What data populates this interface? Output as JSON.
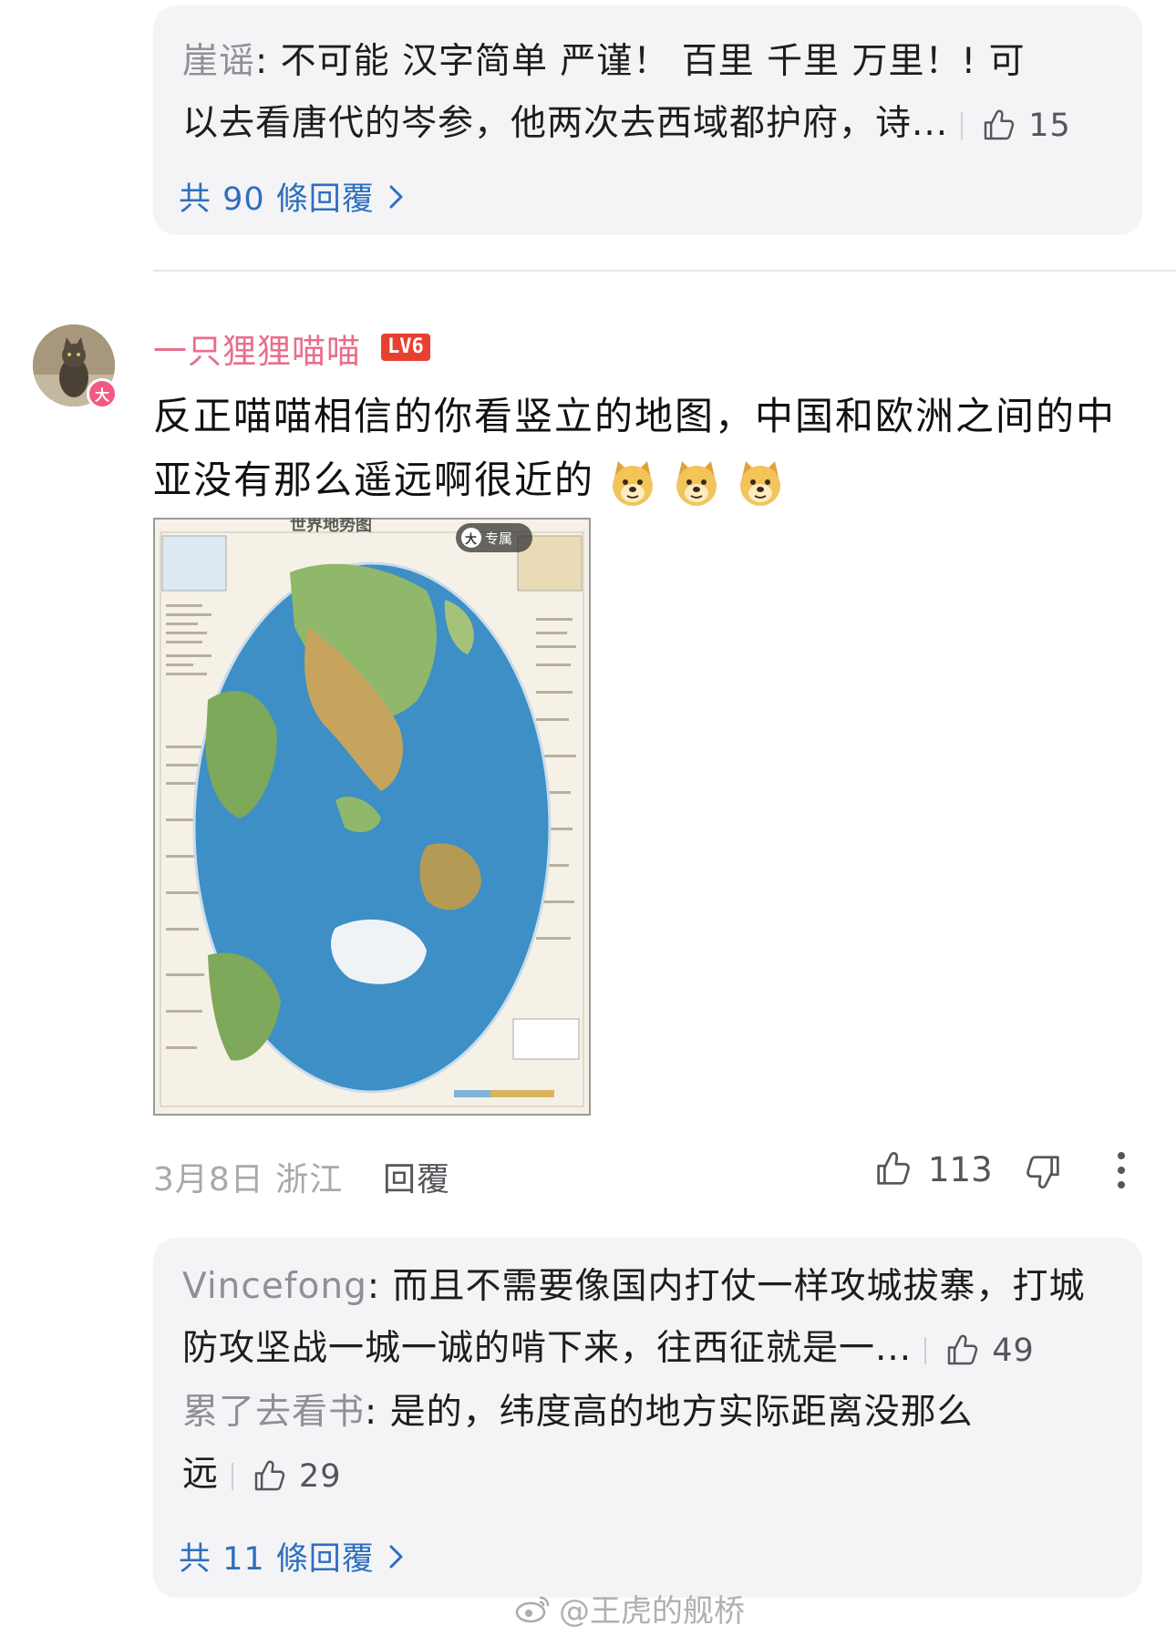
{
  "top_thread": {
    "reply": {
      "user": "崖谣",
      "line1": "不可能 汉字简单  严谨！   百里  千里  万里！! 可",
      "line2": "以去看唐代的岑参，他两次去西域都护府，诗...",
      "likes": "15"
    },
    "more_replies": "共 90 條回覆"
  },
  "comment": {
    "username": "一只狸狸喵喵",
    "level": "LV6",
    "avatar_badge": "大",
    "text_line1": "反正喵喵相信的你看竖立的地图，中国和欧洲之间的中",
    "text_line2": "亚没有那么遥远啊很近的",
    "image": {
      "title": "世界地势图",
      "badge_icon": "大",
      "badge_label": "专属"
    },
    "date": "3月8日 浙江",
    "reply_label": "回覆",
    "likes": "113"
  },
  "bottom_thread": {
    "replies": [
      {
        "user": "Vincefong",
        "line1": "而且不需要像国内打仗一样攻城拔寨，打城",
        "line2": "防攻坚战一城一诚的啃下来，往西征就是一...",
        "likes": "49"
      },
      {
        "user": "累了去看书",
        "line1": "是的，纬度高的地方实际距离没那么",
        "line2": "远",
        "likes": "29"
      }
    ],
    "more_replies": "共 11 條回覆"
  },
  "watermark": "@王虎的舰桥",
  "colors": {
    "link_blue": "#2e6fbf",
    "username_pink": "#e96e8c",
    "level_red": "#e8402f",
    "panel_bg": "#f4f4f6"
  }
}
